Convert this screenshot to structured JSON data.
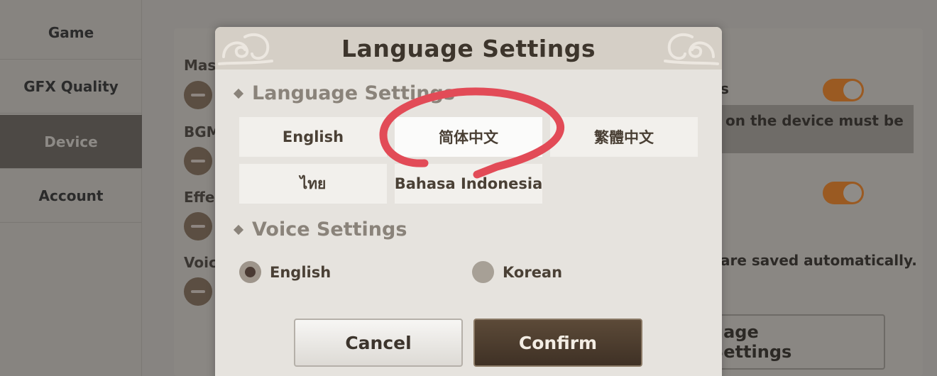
{
  "sidebar": {
    "items": [
      {
        "label": "Game"
      },
      {
        "label": "GFX Quality"
      },
      {
        "label": "Device"
      },
      {
        "label": "Account"
      }
    ]
  },
  "background": {
    "audio_labels": [
      "Mas",
      "BGM",
      "Effe",
      "Voic"
    ],
    "right_label_fragment": "s",
    "notice_fragment": "on the device must be",
    "autosave_fragment": "are saved automatically.",
    "language_button_fragment": "uage Settings"
  },
  "dialog": {
    "title": "Language Settings",
    "language_section_title": "Language Settings",
    "languages": [
      {
        "label": "English",
        "selected": false
      },
      {
        "label": "简体中文",
        "selected": true
      },
      {
        "label": "繁體中文",
        "selected": false
      },
      {
        "label": "ไทย",
        "selected": false
      },
      {
        "label": "Bahasa Indonesia",
        "selected": false
      }
    ],
    "voice_section_title": "Voice Settings",
    "voices": [
      {
        "label": "English",
        "checked": true
      },
      {
        "label": "Korean",
        "checked": false
      }
    ],
    "cancel_label": "Cancel",
    "confirm_label": "Confirm"
  },
  "colors": {
    "accent_dark": "#4a3a2c",
    "toggle_on": "#9a5a22",
    "annotation_red": "#e24b57"
  },
  "icons": [
    "cloud-ornament-icon",
    "diamond-bullet-icon",
    "minus-icon",
    "toggle-switch-icon"
  ]
}
